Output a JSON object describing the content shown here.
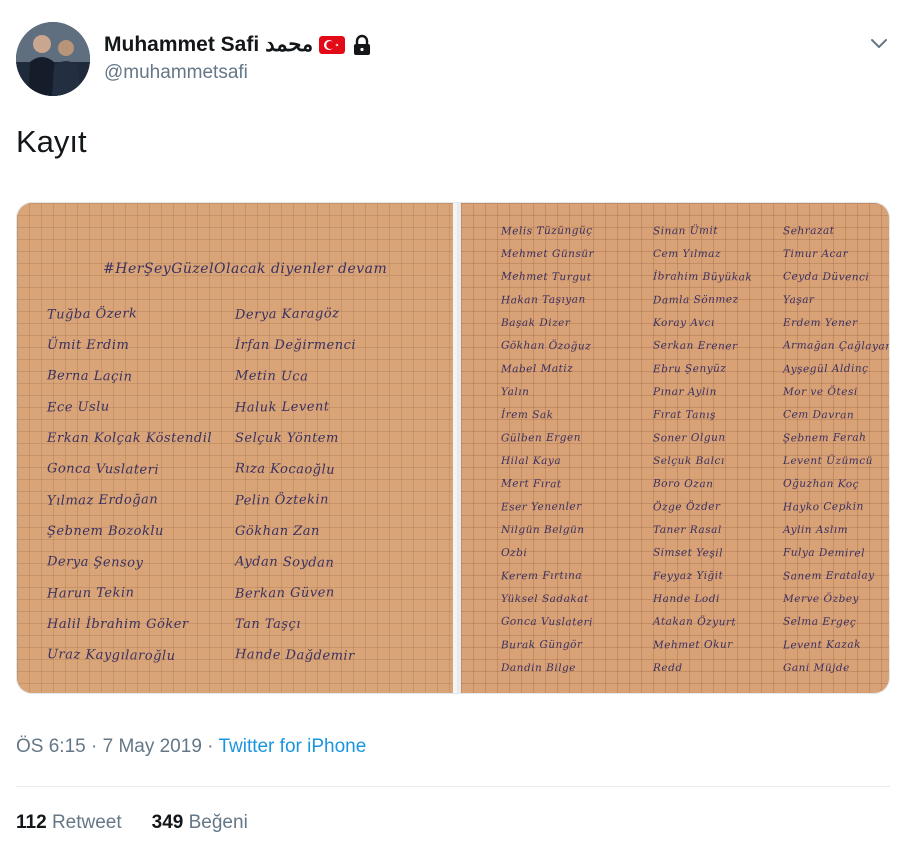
{
  "author": {
    "name": "Muhammet Safi",
    "name_suffix": "محمد",
    "handle": "@muhammetsafi",
    "flag_icon": "turkey-flag-icon",
    "lock_icon": "lock-icon"
  },
  "tweet": {
    "text": "Kayıt"
  },
  "media": {
    "left_page": {
      "heading": "#HerŞeyGüzelOlacak diyenler devam",
      "col1": [
        "Tuğba Özerk",
        "Ümit Erdim",
        "Berna Laçin",
        "Ece Uslu",
        "Erkan Kolçak Köstendil",
        "Gonca Vuslateri",
        "Yılmaz Erdoğan",
        "Şebnem Bozoklu",
        "Derya Şensoy",
        "Harun Tekin",
        "Halil İbrahim Göker",
        "Uraz Kaygılaroğlu"
      ],
      "col2": [
        "Derya Karagöz",
        "İrfan Değirmenci",
        "Metin Uca",
        "Haluk Levent",
        "Selçuk Yöntem",
        "Rıza Kocaoğlu",
        "Pelin Öztekin",
        "Gökhan Zan",
        "Aydan Soydan",
        "Berkan Güven",
        "Tan Taşçı",
        "Hande Dağdemir"
      ]
    },
    "right_page": {
      "col1": [
        "Melis Tüzüngüç",
        "Mehmet Günsür",
        "Mehmet Turgut",
        "Hakan Taşıyan",
        "Başak Dizer",
        "Gökhan Özoğuz",
        "Mabel Matiz",
        "Yalın",
        "İrem Sak",
        "Gülben Ergen",
        "Hilal Kaya",
        "Mert Fırat",
        "Eser Yenenler",
        "Nilgün Belgün",
        "Ozbi",
        "Kerem Fırtına",
        "Yüksel Sadakat",
        "Gonca Vuslateri",
        "Burak Güngör",
        "Dandin Bilge"
      ],
      "col2": [
        "Sinan Ümit",
        "Cem Yılmaz",
        "İbrahim Büyükak",
        "Damla Sönmez",
        "Koray Avcı",
        "Serkan Erener",
        "Ebru Şenyüz",
        "Pınar Aylin",
        "Fırat Tanış",
        "Soner Olgun",
        "Selçuk Balcı",
        "Boro Ozan",
        "Özge Özder",
        "Taner Rasal",
        "Simset Yeşil",
        "Feyyaz Yiğit",
        "Hande Lodi",
        "Atakan Özyurt",
        "Mehmet Okur",
        "Redd"
      ],
      "col3": [
        "Sehrazat",
        "Timur Acar",
        "Ceyda Düvenci",
        "Yaşar",
        "Erdem Yener",
        "Armağan Çağlayan",
        "Ayşegül Aldinç",
        "Mor ve Ötesi",
        "Cem Davran",
        "Şebnem Ferah",
        "Levent Üzümcü",
        "Oğuzhan Koç",
        "Hayko Cepkin",
        "Aylin Aslım",
        "Fulya Demirel",
        "Sanem Eratalay",
        "Merve Özbey",
        "Selma Ergeç",
        "Levent Kazak",
        "Gani Müjde"
      ]
    }
  },
  "meta": {
    "time_date": "ÖS 6:15 · 7 May 2019 · ",
    "source": "Twitter for iPhone"
  },
  "stats": {
    "retweets_count": "112",
    "retweets_label": "Retweet",
    "likes_count": "349",
    "likes_label": "Beğeni"
  },
  "colors": {
    "link": "#1b95e0",
    "muted": "#657786",
    "paper": "#d9a578",
    "ink": "#3a3060"
  }
}
